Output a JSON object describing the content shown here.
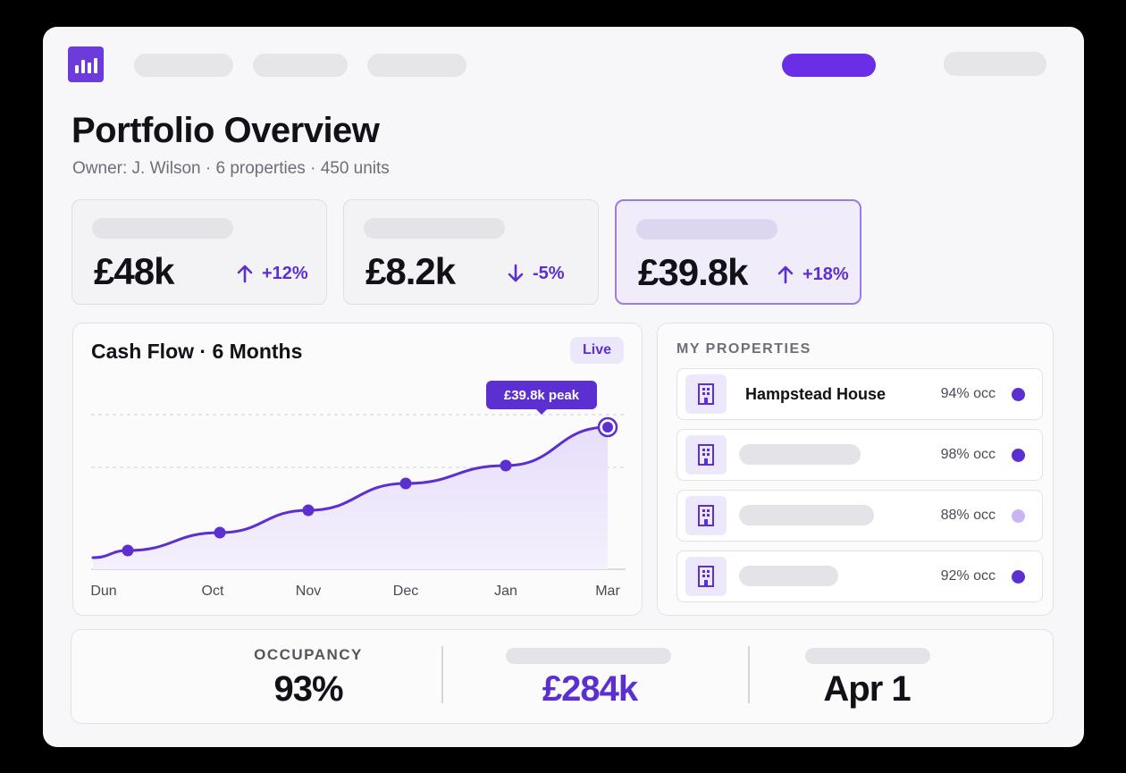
{
  "header": {
    "title": "Portfolio Overview",
    "subtitle": "Owner: J. Wilson · 6 properties · 450 units"
  },
  "kpis": [
    {
      "value": "£48k",
      "trend": "+12%",
      "direction": "up"
    },
    {
      "value": "£8.2k",
      "trend": "-5%",
      "direction": "down"
    },
    {
      "value": "£39.8k",
      "trend": "+18%",
      "direction": "up"
    }
  ],
  "cashflow": {
    "title": "Cash Flow · 6 Months",
    "badge": "Live",
    "peak_label": "£39.8k peak"
  },
  "chart_data": {
    "type": "area",
    "categories": [
      "Dun",
      "Oct",
      "Nov",
      "Dec",
      "Jan",
      "Mar"
    ],
    "series": [
      {
        "values": [
          26,
          28,
          30.5,
          33.5,
          35.5,
          39.8
        ]
      }
    ],
    "accent": "#5b2fd0"
  },
  "properties": {
    "heading": "MY PROPERTIES",
    "items": [
      {
        "name": "Hampstead House",
        "occ": "94% occ",
        "dot": "#5b2fd0"
      },
      {
        "name": "",
        "occ": "98% occ",
        "dot": "#5b2fd0"
      },
      {
        "name": "",
        "occ": "88% occ",
        "dot": "#c9b5f2"
      },
      {
        "name": "",
        "occ": "92% occ",
        "dot": "#5b2fd0"
      }
    ]
  },
  "stats": {
    "occupancy_label": "OCCUPANCY",
    "occupancy_value": "93%",
    "revenue_value": "£284k",
    "date_value": "Apr 1"
  },
  "colors": {
    "accent": "#6a2ee6",
    "accent_text": "#5b2fd0"
  },
  "icons": {
    "logo": "bar-chart-icon",
    "property": "building-icon",
    "trend_up": "arrow-up-icon",
    "trend_down": "arrow-down-icon"
  }
}
